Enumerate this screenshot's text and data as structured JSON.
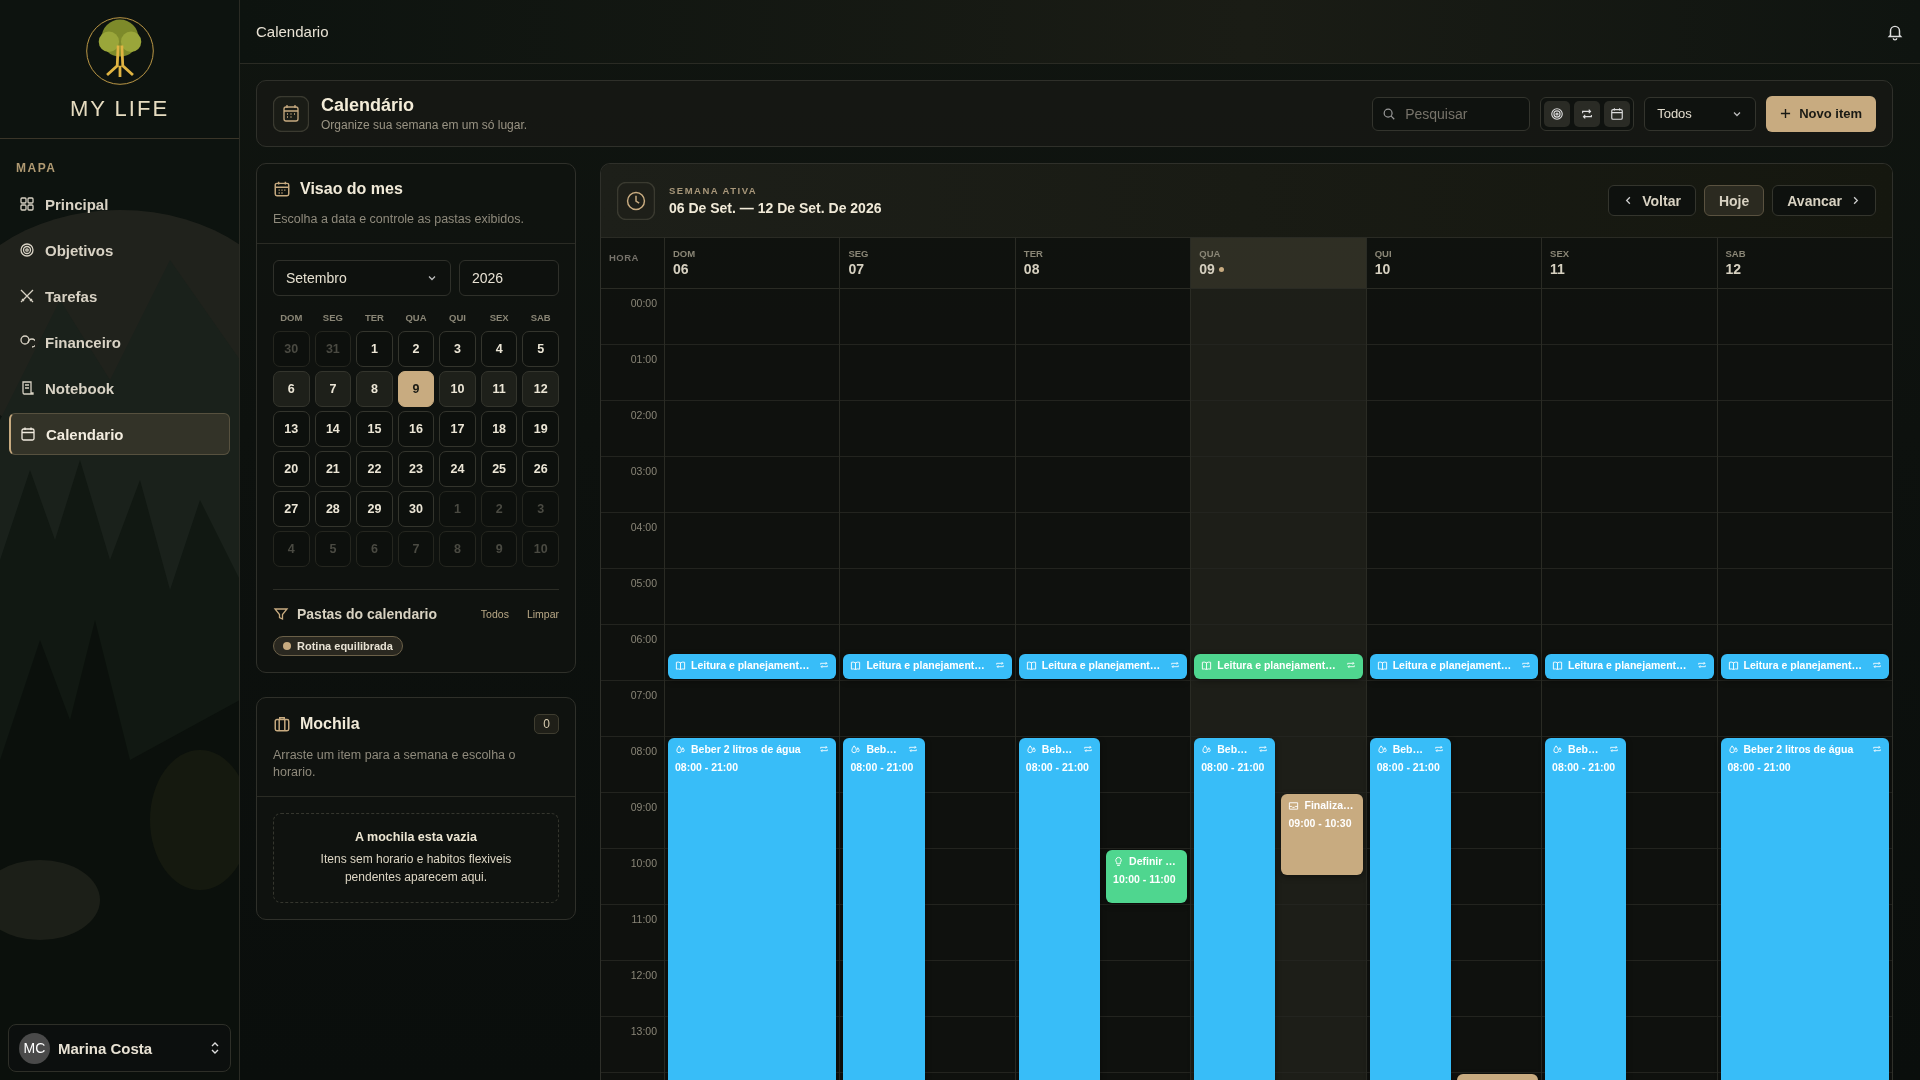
{
  "brand": {
    "name": "MY LIFE"
  },
  "sidebar": {
    "section": "MAPA",
    "items": [
      {
        "label": "Principal",
        "selected": false
      },
      {
        "label": "Objetivos",
        "selected": false
      },
      {
        "label": "Tarefas",
        "selected": false
      },
      {
        "label": "Financeiro",
        "selected": false
      },
      {
        "label": "Notebook",
        "selected": false
      },
      {
        "label": "Calendario",
        "selected": true
      }
    ],
    "user": {
      "initials": "MC",
      "name": "Marina Costa"
    }
  },
  "topbar": {
    "breadcrumb": "Calendario"
  },
  "page_header": {
    "title": "Calendário",
    "subtitle": "Organize sua semana em um só lugar.",
    "search": {
      "placeholder": "Pesquisar"
    },
    "filter": "Todos",
    "new_button": "Novo item"
  },
  "month_panel": {
    "title": "Visao do mes",
    "subtitle": "Escolha a data e controle as pastas exibidos.",
    "month": "Setembro",
    "year": "2026",
    "weekdays": [
      "DOM",
      "SEG",
      "TER",
      "QUA",
      "QUI",
      "SEX",
      "SAB"
    ],
    "days": [
      {
        "day": "30",
        "outside": true,
        "in_week": false,
        "selected": false
      },
      {
        "day": "31",
        "outside": true,
        "in_week": false,
        "selected": false
      },
      {
        "day": "1",
        "outside": false,
        "in_week": false,
        "selected": false
      },
      {
        "day": "2",
        "outside": false,
        "in_week": false,
        "selected": false
      },
      {
        "day": "3",
        "outside": false,
        "in_week": false,
        "selected": false
      },
      {
        "day": "4",
        "outside": false,
        "in_week": false,
        "selected": false
      },
      {
        "day": "5",
        "outside": false,
        "in_week": false,
        "selected": false
      },
      {
        "day": "6",
        "outside": false,
        "in_week": true,
        "selected": false
      },
      {
        "day": "7",
        "outside": false,
        "in_week": true,
        "selected": false
      },
      {
        "day": "8",
        "outside": false,
        "in_week": true,
        "selected": false
      },
      {
        "day": "9",
        "outside": false,
        "in_week": true,
        "selected": true
      },
      {
        "day": "10",
        "outside": false,
        "in_week": true,
        "selected": false
      },
      {
        "day": "11",
        "outside": false,
        "in_week": true,
        "selected": false
      },
      {
        "day": "12",
        "outside": false,
        "in_week": true,
        "selected": false
      },
      {
        "day": "13",
        "outside": false,
        "in_week": false,
        "selected": false
      },
      {
        "day": "14",
        "outside": false,
        "in_week": false,
        "selected": false
      },
      {
        "day": "15",
        "outside": false,
        "in_week": false,
        "selected": false
      },
      {
        "day": "16",
        "outside": false,
        "in_week": false,
        "selected": false
      },
      {
        "day": "17",
        "outside": false,
        "in_week": false,
        "selected": false
      },
      {
        "day": "18",
        "outside": false,
        "in_week": false,
        "selected": false
      },
      {
        "day": "19",
        "outside": false,
        "in_week": false,
        "selected": false
      },
      {
        "day": "20",
        "outside": false,
        "in_week": false,
        "selected": false
      },
      {
        "day": "21",
        "outside": false,
        "in_week": false,
        "selected": false
      },
      {
        "day": "22",
        "outside": false,
        "in_week": false,
        "selected": false
      },
      {
        "day": "23",
        "outside": false,
        "in_week": false,
        "selected": false
      },
      {
        "day": "24",
        "outside": false,
        "in_week": false,
        "selected": false
      },
      {
        "day": "25",
        "outside": false,
        "in_week": false,
        "selected": false
      },
      {
        "day": "26",
        "outside": false,
        "in_week": false,
        "selected": false
      },
      {
        "day": "27",
        "outside": false,
        "in_week": false,
        "selected": false
      },
      {
        "day": "28",
        "outside": false,
        "in_week": false,
        "selected": false
      },
      {
        "day": "29",
        "outside": false,
        "in_week": false,
        "selected": false
      },
      {
        "day": "30",
        "outside": false,
        "in_week": false,
        "selected": false
      },
      {
        "day": "1",
        "outside": true,
        "in_week": false,
        "selected": false
      },
      {
        "day": "2",
        "outside": true,
        "in_week": false,
        "selected": false
      },
      {
        "day": "3",
        "outside": true,
        "in_week": false,
        "selected": false
      },
      {
        "day": "4",
        "outside": true,
        "in_week": false,
        "selected": false
      },
      {
        "day": "5",
        "outside": true,
        "in_week": false,
        "selected": false
      },
      {
        "day": "6",
        "outside": true,
        "in_week": false,
        "selected": false
      },
      {
        "day": "7",
        "outside": true,
        "in_week": false,
        "selected": false
      },
      {
        "day": "8",
        "outside": true,
        "in_week": false,
        "selected": false
      },
      {
        "day": "9",
        "outside": true,
        "in_week": false,
        "selected": false
      },
      {
        "day": "10",
        "outside": true,
        "in_week": false,
        "selected": false
      }
    ],
    "folders_title": "Pastas do calendario",
    "folders_all": "Todos",
    "folders_clear": "Limpar",
    "folders": [
      {
        "label": "Rotina equilibrada",
        "color": "#c8ab80"
      }
    ]
  },
  "backpack": {
    "title": "Mochila",
    "count": "0",
    "subtitle": "Arraste um item para a semana e escolha o horario.",
    "empty_title": "A mochila esta vazia",
    "empty_text": "Itens sem horario e habitos flexiveis pendentes aparecem aqui."
  },
  "week": {
    "eyebrow": "SEMANA ATIVA",
    "range": "06 De Set. — 12 De Set. De 2026",
    "prev": "Voltar",
    "today": "Hoje",
    "next": "Avancar",
    "hour_label": "HORA",
    "hours": [
      "00:00",
      "01:00",
      "02:00",
      "03:00",
      "04:00",
      "05:00",
      "06:00",
      "07:00",
      "08:00",
      "09:00",
      "10:00",
      "11:00",
      "12:00",
      "13:00"
    ],
    "days": [
      {
        "dow": "DOM",
        "date": "06",
        "today": false,
        "events": [
          {
            "kind": "reading",
            "title": "Leitura e planejament…",
            "compact": false,
            "recurring": true,
            "color": "#38bdf8"
          },
          {
            "kind": "habit",
            "title": "Beber 2 litros de água",
            "time": "08:00 - 21:00",
            "compact": false,
            "recurring": true,
            "color": "#38bdf8"
          }
        ]
      },
      {
        "dow": "SEG",
        "date": "07",
        "today": false,
        "events": [
          {
            "kind": "reading",
            "title": "Leitura e planejament…",
            "compact": false,
            "recurring": true,
            "color": "#38bdf8"
          },
          {
            "kind": "habit",
            "title": "Beb…",
            "time": "08:00 - 21:00",
            "compact": true,
            "recurring": true,
            "color": "#38bdf8"
          }
        ]
      },
      {
        "dow": "TER",
        "date": "08",
        "today": false,
        "events": [
          {
            "kind": "reading",
            "title": "Leitura e planejament…",
            "compact": false,
            "recurring": true,
            "color": "#38bdf8"
          },
          {
            "kind": "habit",
            "title": "Beb…",
            "time": "08:00 - 21:00",
            "compact": true,
            "recurring": true,
            "color": "#38bdf8"
          },
          {
            "kind": "idea",
            "title": "Definir …",
            "time": "10:00 - 11:00",
            "compact": true,
            "recurring": false,
            "color": "#4fd68f"
          }
        ]
      },
      {
        "dow": "QUA",
        "date": "09",
        "today": true,
        "events": [
          {
            "kind": "reading",
            "title": "Leitura e planejament…",
            "compact": false,
            "recurring": true,
            "color": "#4fd68f"
          },
          {
            "kind": "habit",
            "title": "Beb…",
            "time": "08:00 - 21:00",
            "compact": true,
            "recurring": true,
            "color": "#38bdf8"
          },
          {
            "kind": "task",
            "title": "Finaliza…",
            "time": "09:00 - 10:30",
            "compact": true,
            "recurring": false,
            "color": "#c8ab80"
          }
        ]
      },
      {
        "dow": "QUI",
        "date": "10",
        "today": false,
        "events": [
          {
            "kind": "reading",
            "title": "Leitura e planejament…",
            "compact": false,
            "recurring": true,
            "color": "#38bdf8"
          },
          {
            "kind": "habit",
            "title": "Beb…",
            "time": "08:00 - 21:00",
            "compact": true,
            "recurring": true,
            "color": "#38bdf8"
          },
          {
            "kind": "peek",
            "compact": true,
            "color": "#c8ab80"
          }
        ]
      },
      {
        "dow": "SEX",
        "date": "11",
        "today": false,
        "events": [
          {
            "kind": "reading",
            "title": "Leitura e planejament…",
            "compact": false,
            "recurring": true,
            "color": "#38bdf8"
          },
          {
            "kind": "habit",
            "title": "Beb…",
            "time": "08:00 - 21:00",
            "compact": true,
            "recurring": true,
            "color": "#38bdf8"
          }
        ]
      },
      {
        "dow": "SAB",
        "date": "12",
        "today": false,
        "events": [
          {
            "kind": "reading",
            "title": "Leitura e planejament…",
            "compact": false,
            "recurring": true,
            "color": "#38bdf8"
          },
          {
            "kind": "habit",
            "title": "Beber 2 litros de água",
            "time": "08:00 - 21:00",
            "compact": false,
            "recurring": true,
            "color": "#38bdf8"
          }
        ]
      }
    ]
  }
}
